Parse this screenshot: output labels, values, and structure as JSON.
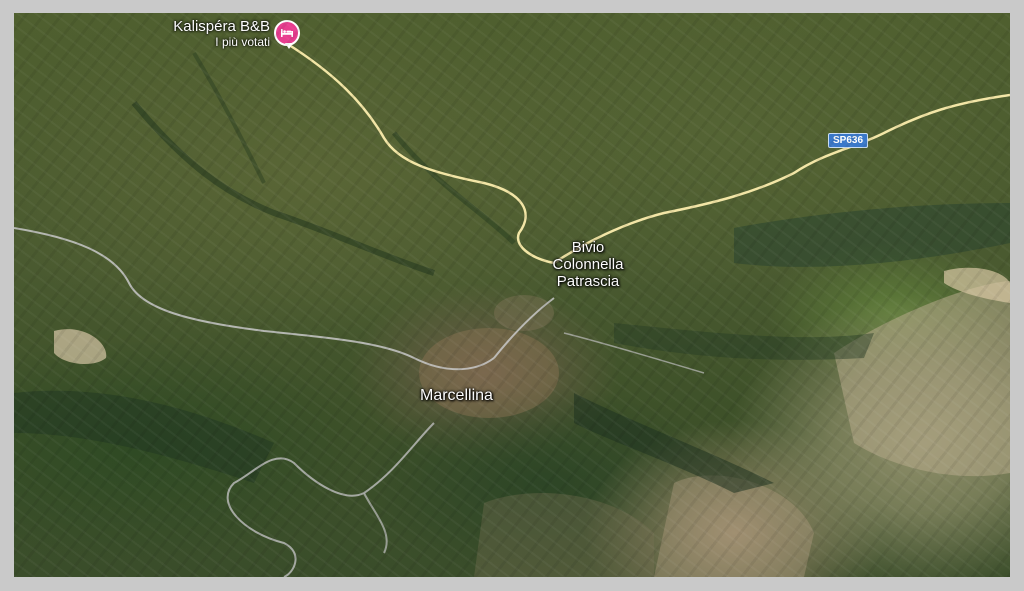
{
  "map": {
    "view": "satellite",
    "places": {
      "bivio_line1": "Bivio",
      "bivio_line2": "Colonnella",
      "bivio_line3": "Patrascia",
      "marcellina": "Marcellina"
    },
    "poi": {
      "name": "Kalispéra B&B",
      "subtitle": "I più votati",
      "icon": "bed-icon",
      "color": "#e83d8f"
    },
    "road_shield": {
      "label": "SP636",
      "color": "#3a78c9"
    },
    "colors": {
      "road": "#f3e6a6",
      "secondary_road": "#c8c8c8",
      "frame": "#c9c9c9"
    }
  }
}
